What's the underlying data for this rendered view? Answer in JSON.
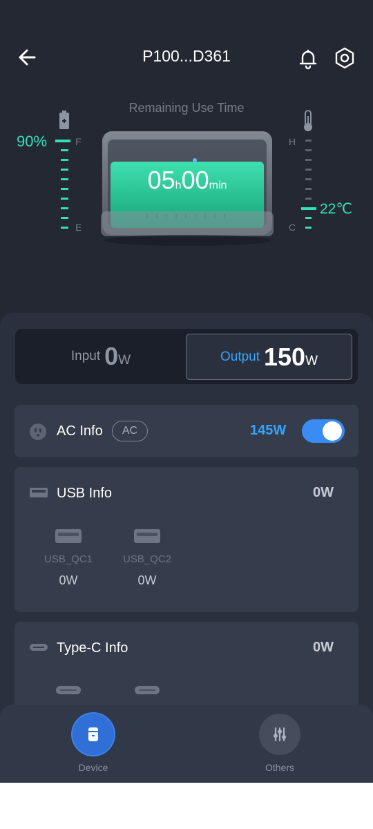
{
  "header": {
    "title": "P100...D361"
  },
  "hero": {
    "remaining_label": "Remaining Use Time",
    "battery_percent": "90%",
    "battery_level": 0.9,
    "gauge_full": "F",
    "gauge_empty": "E",
    "temp_high": "H",
    "temp_low": "C",
    "temperature": "22℃",
    "time_hours": "05",
    "time_h_unit": "h",
    "time_minutes": "00",
    "time_min_unit": "min"
  },
  "switcher": {
    "input_label": "Input",
    "input_value": "0",
    "input_unit": "W",
    "output_label": "Output",
    "output_value": "150",
    "output_unit": "W",
    "selected": "output"
  },
  "ac": {
    "title": "AC Info",
    "badge": "AC",
    "watt": "145W",
    "enabled": true
  },
  "usb": {
    "title": "USB Info",
    "watt": "0W",
    "ports": [
      {
        "name": "USB_QC1",
        "value": "0W"
      },
      {
        "name": "USB_QC2",
        "value": "0W"
      }
    ]
  },
  "typec": {
    "title": "Type-C Info",
    "watt": "0W"
  },
  "nav": {
    "device": "Device",
    "others": "Others"
  },
  "colors": {
    "accent_green": "#35e0b9",
    "accent_blue": "#35a4ff",
    "background": "#232833"
  }
}
